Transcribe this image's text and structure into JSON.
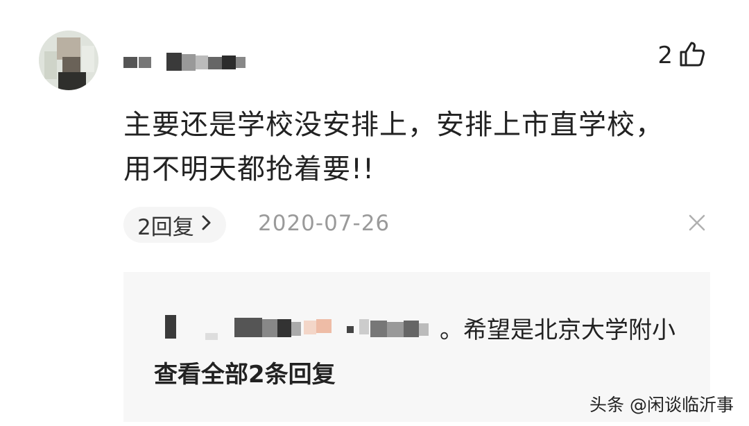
{
  "comment": {
    "like_count": "2",
    "text_line1": "主要还是学校没安排上，安排上市直学校，",
    "text_line2": "用不明天都抢着要!!",
    "reply_pill_label": "2回复",
    "date": "2020-07-26"
  },
  "reply_preview": {
    "text": "。希望是北京大学附小",
    "view_all_label": "查看全部2条回复"
  },
  "watermark": "头条 @闲谈临沂事",
  "icons": {
    "like": "thumbs-up-icon",
    "chevron": "chevron-right-icon",
    "close": "close-icon"
  }
}
